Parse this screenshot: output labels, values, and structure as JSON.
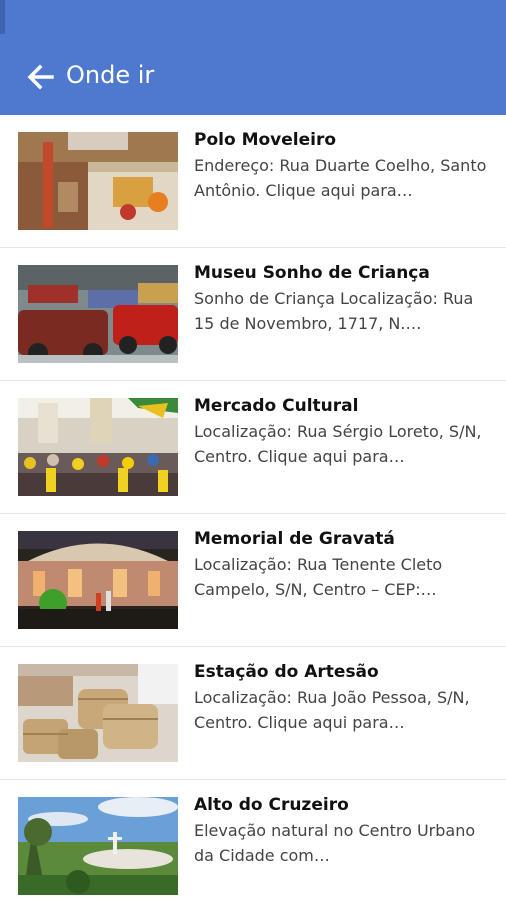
{
  "app_bar": {
    "title": "Onde ir",
    "back_icon": "arrow-left-icon",
    "color": "#4f79cf"
  },
  "places": [
    {
      "title": "Polo Moveleiro",
      "description": "Endereço: Rua Duarte Coelho, Santo Antônio. Clique aqui para…",
      "thumbnail": "furniture-market-photo"
    },
    {
      "title": "Museu Sonho de Criança",
      "description": "Sonho de Criança Localização: Rua 15 de Novembro, 1717, N.…",
      "thumbnail": "vintage-cars-museum-photo"
    },
    {
      "title": "Mercado Cultural",
      "description": "Localização: Rua Sérgio Loreto, S/N, Centro. Clique aqui para…",
      "thumbnail": "crowded-market-photo"
    },
    {
      "title": "Memorial de Gravatá",
      "description": "Localização: Rua Tenente Cleto Campelo, S/N, Centro – CEP:…",
      "thumbnail": "lit-memorial-building-photo"
    },
    {
      "title": "Estação do Artesão",
      "description": "Localização: Rua João Pessoa, S/N, Centro. Clique aqui para…",
      "thumbnail": "wicker-crafts-photo"
    },
    {
      "title": "Alto do Cruzeiro",
      "description": "Elevação natural no Centro Urbano da Cidade com…",
      "thumbnail": "hilltop-cross-landscape-photo"
    }
  ]
}
